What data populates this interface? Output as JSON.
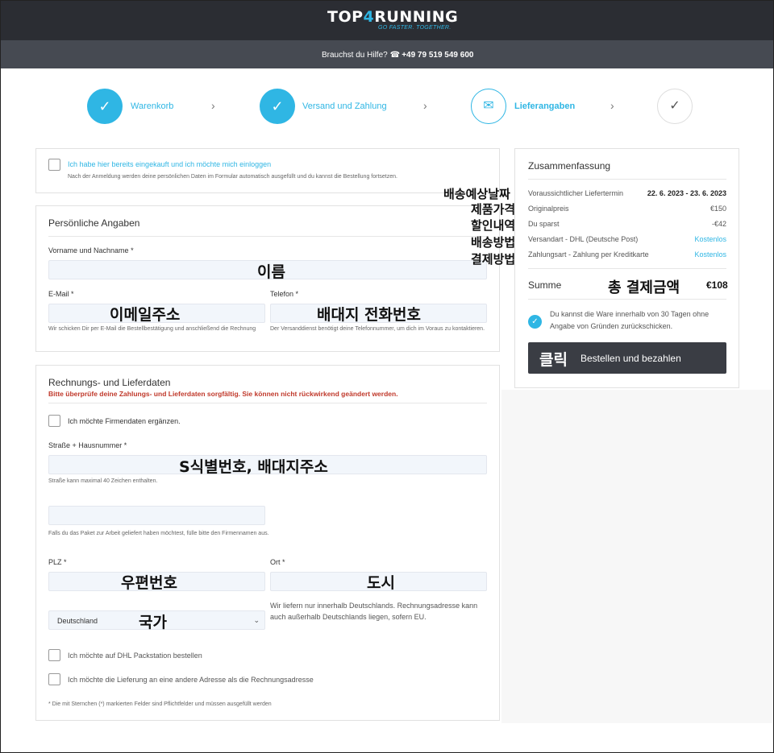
{
  "brand": {
    "logo_a": "TOP",
    "logo_four": "4",
    "logo_b": "RUNNING",
    "tagline": "GO FASTER. TOGETHER."
  },
  "help": {
    "text": "Brauchst du Hilfe?",
    "phone": "+49 79 519 549 600"
  },
  "steps": [
    {
      "label": "Warenkorb",
      "icon": "check-icon"
    },
    {
      "label": "Versand und Zahlung",
      "icon": "check-icon"
    },
    {
      "label": "Lieferangaben",
      "icon": "envelope-icon"
    },
    {
      "label": "",
      "icon": "check-icon"
    }
  ],
  "login": {
    "label": "Ich habe hier bereits eingekauft und ich möchte mich einloggen",
    "hint": "Nach der Anmeldung werden deine persönlichen Daten im Formular automatisch ausgefüllt und du kannst die Bestellung fortsetzen."
  },
  "personal": {
    "title": "Persönliche Angaben",
    "name_label": "Vorname und Nachname *",
    "name_value": "이름",
    "email_label": "E-Mail *",
    "email_value": "이메일주소",
    "email_hint": "Wir schicken Dir per E-Mail die Bestellbestätigung und anschließend die Rechnung",
    "phone_label": "Telefon *",
    "phone_value": "배대지 전화번호",
    "phone_hint": "Der Versanddienst benötigt deine Telefonnummer, um dich im Voraus zu kontaktieren."
  },
  "billing": {
    "title": "Rechnungs- und Lieferdaten",
    "warning": "Bitte überprüfe deine Zahlungs- und Lieferdaten sorgfältig. Sie können nicht rückwirkend geändert werden.",
    "company_label": "Ich möchte Firmendaten ergänzen.",
    "street_label": "Straße + Hausnummer *",
    "street_value": "S식별번호, 배대지주소",
    "street_hint": "Straße kann maximal 40 Zeichen enthalten.",
    "extra_hint": "Falls du das Paket zur Arbeit geliefert haben möchtest, fülle bitte den Firmennamen aus.",
    "zip_label": "PLZ *",
    "zip_value": "우편번호",
    "city_label": "Ort *",
    "city_value": "도시",
    "country_value": "Deutschland",
    "country_annot": "국가",
    "delivery_hint": "Wir liefern nur innerhalb Deutschlands. Rechnungsadresse kann auch außerhalb Deutschlands liegen, sofern EU.",
    "packstation_label": "Ich möchte auf DHL Packstation bestellen",
    "other_address_label": "Ich möchte die Lieferung an eine andere Adresse als die Rechnungsadresse",
    "required_note": "* Die mit Sternchen (*) markierten Felder sind Pflichtfelder und müssen ausgefüllt werden"
  },
  "summary": {
    "title": "Zusammenfassung",
    "rows": [
      {
        "label": "Voraussichtlicher Liefertermin",
        "value": "22. 6. 2023 - 23. 6. 2023",
        "annot": "배송예상날짜"
      },
      {
        "label": "Originalpreis",
        "value": "€150",
        "annot": "제품가격"
      },
      {
        "label": "Du sparst",
        "value": "-€42",
        "annot": "할인내역"
      },
      {
        "label": "Versandart - DHL (Deutsche Post)",
        "value": "Kostenlos",
        "annot": "배송방법"
      },
      {
        "label": "Zahlungsart - Zahlung per Kreditkarte",
        "value": "Kostenlos",
        "annot": "결제방법"
      }
    ],
    "total_label": "Summe",
    "total_annot": "총 결제금액",
    "total_value": "€108",
    "return_text": "Du kannst die Ware innerhalb von 30 Tagen ohne Angabe von Gründen zurückschicken.",
    "button_annot": "클릭",
    "button_label": "Bestellen und bezahlen"
  },
  "colors": {
    "accent": "#2fb6e4",
    "topbar": "#2b2d33",
    "helpbar": "#464a52",
    "warning": "#c0392b"
  }
}
